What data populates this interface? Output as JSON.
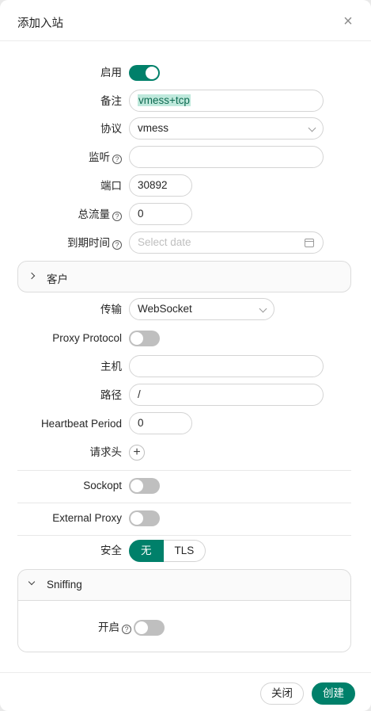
{
  "modal": {
    "title": "添加入站"
  },
  "form": {
    "enable": {
      "label": "启用",
      "on": true
    },
    "remark": {
      "label": "备注",
      "value": "vmess+tcp"
    },
    "protocol": {
      "label": "协议",
      "value": "vmess"
    },
    "listen": {
      "label": "监听",
      "value": ""
    },
    "port": {
      "label": "端口",
      "value": "30892"
    },
    "total_traffic": {
      "label": "总流量",
      "value": "0"
    },
    "expiry": {
      "label": "到期时间",
      "placeholder": "Select date"
    }
  },
  "client_panel": {
    "title": "客户"
  },
  "stream": {
    "transmission": {
      "label": "传输",
      "value": "WebSocket"
    },
    "proxy_protocol": {
      "label": "Proxy Protocol",
      "on": false
    },
    "host": {
      "label": "主机",
      "value": ""
    },
    "path": {
      "label": "路径",
      "value": "/"
    },
    "heartbeat": {
      "label": "Heartbeat Period",
      "value": "0"
    },
    "headers": {
      "label": "请求头"
    }
  },
  "sockopt": {
    "label": "Sockopt",
    "on": false
  },
  "external_proxy": {
    "label": "External Proxy",
    "on": false
  },
  "security": {
    "label": "安全",
    "options": [
      "无",
      "TLS"
    ],
    "selected": "无"
  },
  "sniffing": {
    "title": "Sniffing",
    "enable_label": "开启",
    "on": false
  },
  "footer": {
    "close_label": "关闭",
    "create_label": "创建"
  },
  "icons": {
    "help": "question-circle-icon",
    "close": "close-icon",
    "calendar": "calendar-icon",
    "plus": "plus-icon"
  },
  "colors": {
    "accent": "#00806a",
    "highlight": "#bfe9dc"
  }
}
